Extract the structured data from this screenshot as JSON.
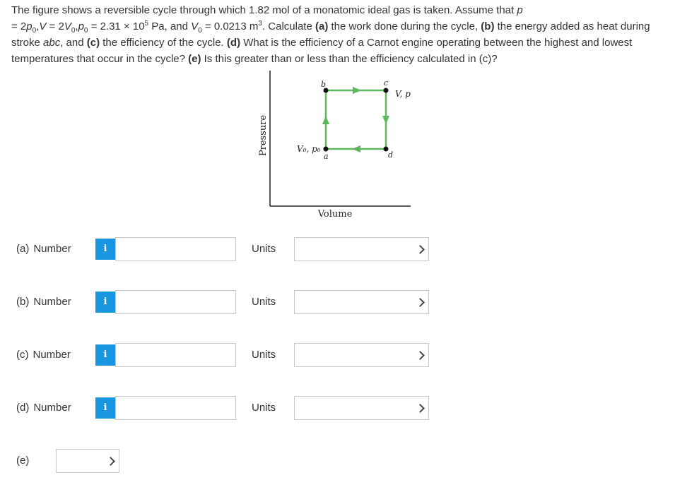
{
  "question": {
    "t1": "The figure shows a reversible cycle through which 1.82 mol of a monatomic ideal gas is taken. Assume that ",
    "p": "p",
    "t2": "= 2",
    "p0a": "p",
    "t3": "0",
    "t4": ",",
    "V": "V",
    "t5": " = 2",
    "V0a": "V",
    "t6": "0",
    "t7": ",",
    "p0b": "p",
    "t8": "0",
    "t9": " = 2.31 × 10",
    "exp5": "5",
    "t10": " Pa, and ",
    "V0b": "V",
    "t11": "0",
    "t12": " = 0.0213 m",
    "exp3": "3",
    "t13": ". Calculate ",
    "pa": "(a)",
    "t14": " the work done during the cycle, ",
    "pb": "(b)",
    "t15": " the energy added as heat during stroke ",
    "abc": "abc",
    "t16": ", and ",
    "pc": "(c)",
    "t17": " the efficiency of the cycle. ",
    "pd": "(d)",
    "t18": " What is the efficiency of a Carnot engine operating between the highest and lowest temperatures that occur in the cycle? ",
    "pe": "(e)",
    "t19": " Is this greater than or less than the efficiency calculated in (c)?"
  },
  "figure": {
    "y_axis_label": "Pressure",
    "x_axis_label": "Volume",
    "point_a": "a",
    "point_b": "b",
    "point_c": "c",
    "point_d": "d",
    "label_a": "V₀, p₀",
    "label_c": "V, p",
    "cycle_color": "#5cb85c",
    "point_color": "#111111"
  },
  "rows": [
    {
      "part": "(a)",
      "number_label": "Number",
      "info": "i",
      "value": "",
      "units_label": "Units",
      "units_value": ""
    },
    {
      "part": "(b)",
      "number_label": "Number",
      "info": "i",
      "value": "",
      "units_label": "Units",
      "units_value": ""
    },
    {
      "part": "(c)",
      "number_label": "Number",
      "info": "i",
      "value": "",
      "units_label": "Units",
      "units_value": ""
    },
    {
      "part": "(d)",
      "number_label": "Number",
      "info": "i",
      "value": "",
      "units_label": "Units",
      "units_value": ""
    }
  ],
  "row_e": {
    "part": "(e)",
    "value": ""
  },
  "colors": {
    "info_button": "#1a95e0",
    "text": "#333333",
    "input_border": "#c8c8c8"
  }
}
